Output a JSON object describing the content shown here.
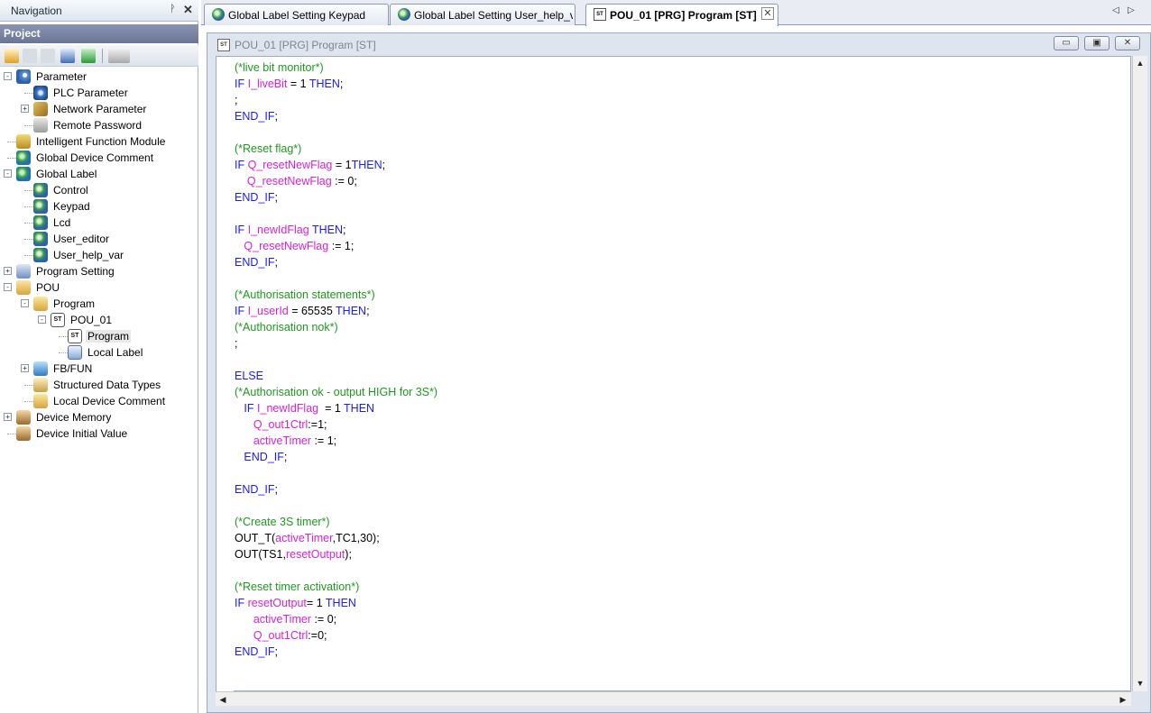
{
  "navigation": {
    "title": "Navigation",
    "pin_glyph": "ᚹ",
    "close_glyph": "✕",
    "project_label": "Project",
    "tree": [
      {
        "label": "Parameter",
        "icon": "parameter-icon"
      },
      {
        "label": "PLC Parameter",
        "icon": "gear-icon"
      },
      {
        "label": "Network Parameter",
        "icon": "network-icon"
      },
      {
        "label": "Remote Password",
        "icon": "lock-icon"
      },
      {
        "label": "Intelligent Function Module",
        "icon": "module-icon"
      },
      {
        "label": "Global Device Comment",
        "icon": "globe-icon"
      },
      {
        "label": "Global Label",
        "icon": "globe-icon"
      },
      {
        "label": "Control",
        "icon": "label-icon"
      },
      {
        "label": "Keypad",
        "icon": "label-icon"
      },
      {
        "label": "Lcd",
        "icon": "label-icon"
      },
      {
        "label": "User_editor",
        "icon": "label-icon"
      },
      {
        "label": "User_help_var",
        "icon": "label-icon"
      },
      {
        "label": "Program Setting",
        "icon": "program-setting-icon"
      },
      {
        "label": "POU",
        "icon": "folder-icon"
      },
      {
        "label": "Program",
        "icon": "folder-icon"
      },
      {
        "label": "POU_01",
        "icon": "st-icon"
      },
      {
        "label": "Program",
        "icon": "st-icon"
      },
      {
        "label": "Local Label",
        "icon": "table-icon"
      },
      {
        "label": "FB/FUN",
        "icon": "fb-icon"
      },
      {
        "label": "Structured Data Types",
        "icon": "struct-icon"
      },
      {
        "label": "Local Device Comment",
        "icon": "folder-icon"
      },
      {
        "label": "Device Memory",
        "icon": "memory-icon"
      },
      {
        "label": "Device Initial Value",
        "icon": "memory-icon"
      }
    ]
  },
  "tabs": [
    {
      "label": "Global Label Setting Keypad"
    },
    {
      "label": "Global Label Setting User_help_var"
    },
    {
      "label": "POU_01 [PRG] Program [ST]"
    }
  ],
  "tab_close_glyph": "✕",
  "tab_nav": {
    "prev": "◁",
    "next": "▷"
  },
  "editor": {
    "title": "POU_01 [PRG] Program [ST]",
    "st_badge": "ST",
    "minimize": "▭",
    "restore": "▣",
    "close": "✕"
  },
  "code_lines": [
    [
      {
        "t": "(*live bit monitor*)",
        "c": "cm"
      }
    ],
    [
      {
        "t": "IF ",
        "c": "kw"
      },
      {
        "t": "I_liveBit",
        "c": "vr"
      },
      {
        "t": " = 1 ",
        "c": "pl"
      },
      {
        "t": "THEN",
        "c": "kw"
      },
      {
        "t": ";",
        "c": "pl"
      }
    ],
    [
      {
        "t": ";",
        "c": "pl"
      }
    ],
    [
      {
        "t": "END_IF",
        "c": "kw"
      },
      {
        "t": ";",
        "c": "pl"
      }
    ],
    [],
    [
      {
        "t": "(*Reset flag*)",
        "c": "cm"
      }
    ],
    [
      {
        "t": "IF ",
        "c": "kw"
      },
      {
        "t": "Q_resetNewFlag",
        "c": "vr"
      },
      {
        "t": " = 1",
        "c": "pl"
      },
      {
        "t": "THEN",
        "c": "kw"
      },
      {
        "t": ";",
        "c": "pl"
      }
    ],
    [
      {
        "t": "    ",
        "c": "pl"
      },
      {
        "t": "Q_resetNewFlag",
        "c": "vr"
      },
      {
        "t": " := 0;",
        "c": "pl"
      }
    ],
    [
      {
        "t": "END_IF",
        "c": "kw"
      },
      {
        "t": ";",
        "c": "pl"
      }
    ],
    [],
    [
      {
        "t": "IF ",
        "c": "kw"
      },
      {
        "t": "I_newIdFlag",
        "c": "vr"
      },
      {
        "t": " THEN",
        "c": "kw"
      },
      {
        "t": ";",
        "c": "pl"
      }
    ],
    [
      {
        "t": "   ",
        "c": "pl"
      },
      {
        "t": "Q_resetNewFlag",
        "c": "vr"
      },
      {
        "t": " := 1;",
        "c": "pl"
      }
    ],
    [
      {
        "t": "END_IF",
        "c": "kw"
      },
      {
        "t": ";",
        "c": "pl"
      }
    ],
    [],
    [
      {
        "t": "(*Authorisation statements*)",
        "c": "cm"
      }
    ],
    [
      {
        "t": "IF ",
        "c": "kw"
      },
      {
        "t": "I_userId",
        "c": "vr"
      },
      {
        "t": " = 65535 ",
        "c": "pl"
      },
      {
        "t": "THEN",
        "c": "kw"
      },
      {
        "t": ";",
        "c": "pl"
      }
    ],
    [
      {
        "t": "(*Authorisation nok*)",
        "c": "cm"
      }
    ],
    [
      {
        "t": ";",
        "c": "pl"
      }
    ],
    [],
    [
      {
        "t": "ELSE",
        "c": "kw"
      }
    ],
    [
      {
        "t": "(*Authorisation ok - output HIGH for 3S*)",
        "c": "cm"
      }
    ],
    [
      {
        "t": "   ",
        "c": "pl"
      },
      {
        "t": "IF ",
        "c": "kw"
      },
      {
        "t": "I_newIdFlag",
        "c": "vr"
      },
      {
        "t": "  = 1 ",
        "c": "pl"
      },
      {
        "t": "THEN",
        "c": "kw"
      }
    ],
    [
      {
        "t": "      ",
        "c": "pl"
      },
      {
        "t": "Q_out1Ctrl",
        "c": "vr"
      },
      {
        "t": ":=1;",
        "c": "pl"
      }
    ],
    [
      {
        "t": "      ",
        "c": "pl"
      },
      {
        "t": "activeTimer",
        "c": "vr"
      },
      {
        "t": " := 1;",
        "c": "pl"
      }
    ],
    [
      {
        "t": "   ",
        "c": "pl"
      },
      {
        "t": "END_IF",
        "c": "kw"
      },
      {
        "t": ";",
        "c": "pl"
      }
    ],
    [],
    [
      {
        "t": "END_IF",
        "c": "kw"
      },
      {
        "t": ";",
        "c": "pl"
      }
    ],
    [],
    [
      {
        "t": "(*Create 3S timer*)",
        "c": "cm"
      }
    ],
    [
      {
        "t": "OUT_T(",
        "c": "pl"
      },
      {
        "t": "activeTimer",
        "c": "vr"
      },
      {
        "t": ",TC1,30);",
        "c": "pl"
      }
    ],
    [
      {
        "t": "OUT(TS1,",
        "c": "pl"
      },
      {
        "t": "resetOutput",
        "c": "vr"
      },
      {
        "t": ");",
        "c": "pl"
      }
    ],
    [],
    [
      {
        "t": "(*Reset timer activation*)",
        "c": "cm"
      }
    ],
    [
      {
        "t": "IF ",
        "c": "kw"
      },
      {
        "t": "resetOutput",
        "c": "vr"
      },
      {
        "t": "= 1 ",
        "c": "pl"
      },
      {
        "t": "THEN",
        "c": "kw"
      }
    ],
    [
      {
        "t": "      ",
        "c": "pl"
      },
      {
        "t": "activeTimer",
        "c": "vr"
      },
      {
        "t": " := 0;",
        "c": "pl"
      }
    ],
    [
      {
        "t": "      ",
        "c": "pl"
      },
      {
        "t": "Q_out1Ctrl",
        "c": "vr"
      },
      {
        "t": ":=0;",
        "c": "pl"
      }
    ],
    [
      {
        "t": "END_IF",
        "c": "kw"
      },
      {
        "t": ";",
        "c": "pl"
      }
    ]
  ],
  "scroll": {
    "up": "▲",
    "down": "▼",
    "left": "◀",
    "right": "▶"
  },
  "colors": {
    "comment": "#1e9a1e",
    "keyword": "#1a1aff",
    "variable": "#d622d6"
  }
}
